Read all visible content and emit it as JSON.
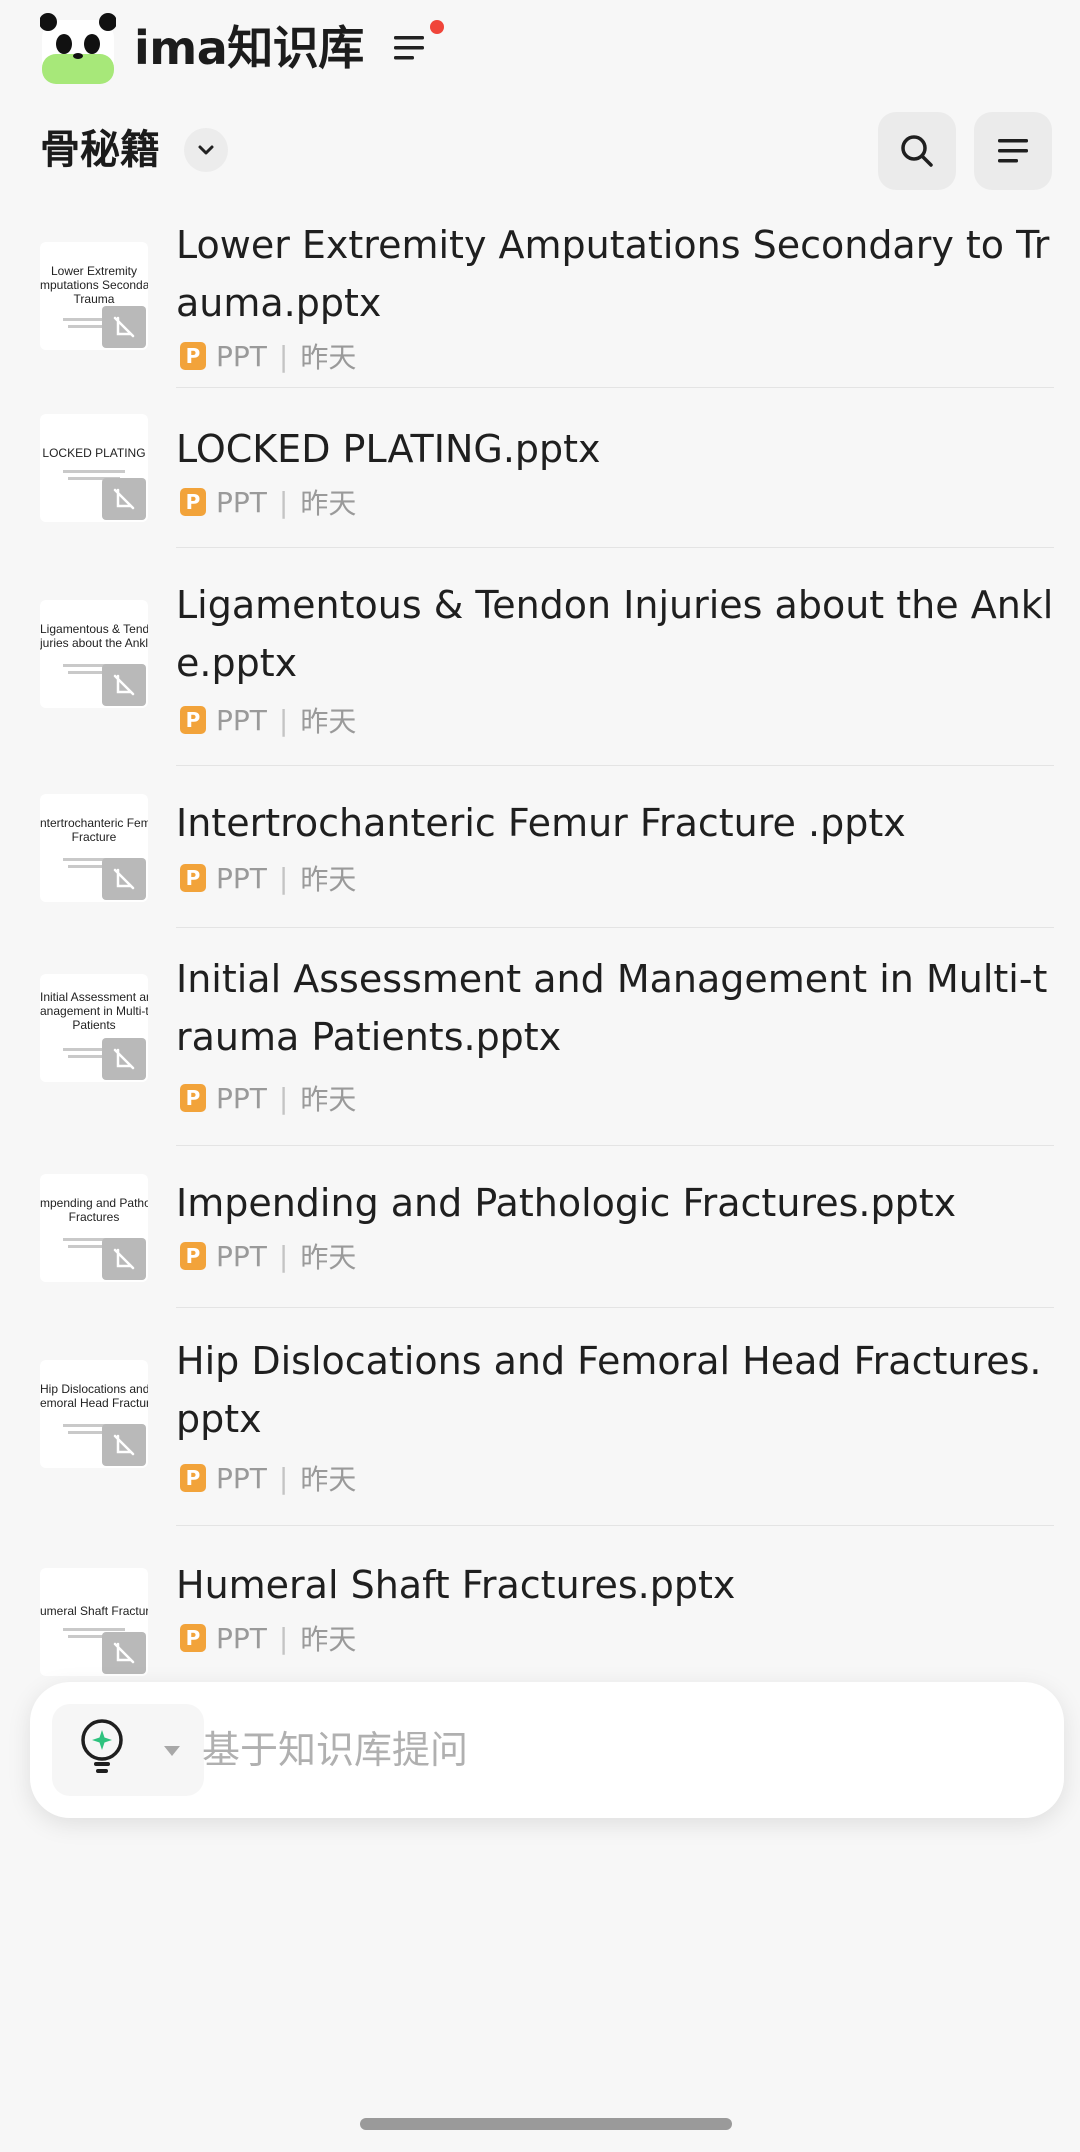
{
  "app": {
    "title": "ima知识库"
  },
  "knowledge_base": {
    "name": "骨秘籍"
  },
  "colors": {
    "accent": "#f2a33a",
    "notification": "#f0453a",
    "logo_green": "#a7e879"
  },
  "files": [
    {
      "name": "Lower Extremity Amputations Secondary to Trauma.pptx",
      "type": "PPT",
      "date": "昨天",
      "thumb_title": "Lower Extremity\nmputations Secondary\nTrauma"
    },
    {
      "name": "LOCKED PLATING.pptx",
      "type": "PPT",
      "date": "昨天",
      "thumb_title": "LOCKED PLATING"
    },
    {
      "name": "Ligamentous & Tendon Injuries about the Ankle.pptx",
      "type": "PPT",
      "date": "昨天",
      "thumb_title": "Ligamentous & Tendon\njuries about the Ankl"
    },
    {
      "name": "Intertrochanteric Femur Fracture .pptx",
      "type": "PPT",
      "date": "昨天",
      "thumb_title": "ntertrochanteric Femu\nFracture"
    },
    {
      "name": "Initial Assessment and Management in Multi-trauma Patients.pptx",
      "type": "PPT",
      "date": "昨天",
      "thumb_title": "Initial Assessment and\nanagement in Multi-traur\nPatients"
    },
    {
      "name": "Impending and Pathologic Fractures.pptx",
      "type": "PPT",
      "date": "昨天",
      "thumb_title": "mpending and Patholog\nFractures"
    },
    {
      "name": "Hip Dislocations and Femoral Head Fractures.pptx",
      "type": "PPT",
      "date": "昨天",
      "thumb_title": "Hip Dislocations and\nemoral Head Fracture"
    },
    {
      "name": "Humeral Shaft Fractures.pptx",
      "type": "PPT",
      "date": "昨天",
      "thumb_title": "umeral Shaft Fracture"
    }
  ],
  "ask": {
    "placeholder": "基于知识库提问"
  },
  "icons": {
    "logo": "panda-logo-icon",
    "menu": "menu-lines-icon",
    "dropdown": "chevron-down-icon",
    "search": "search-icon",
    "sort": "sort-lines-icon",
    "file_badge": "unavailable-icon",
    "file_type": "ppt-icon",
    "model": "lightbulb-sparkle-icon"
  }
}
